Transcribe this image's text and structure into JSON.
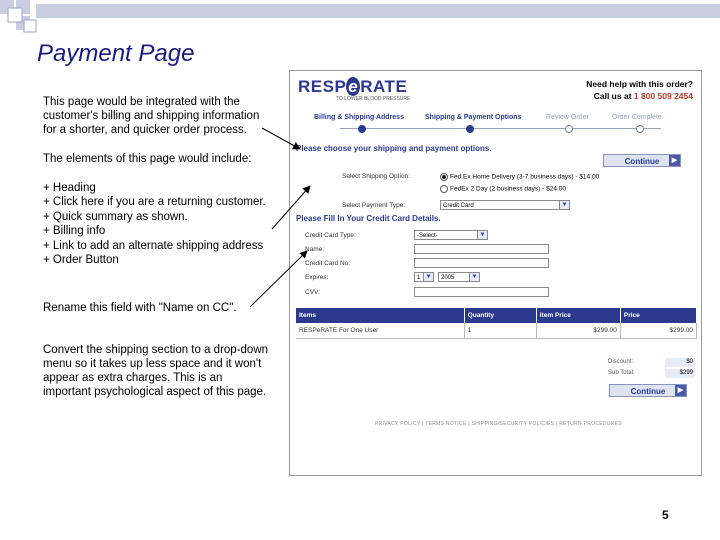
{
  "slide": {
    "title": "Payment Page",
    "intro": [
      "This page would be integrated with the",
      "customer's billing and shipping information",
      "for a shorter, and quicker order process."
    ],
    "elements_heading": "The elements of this page would include:",
    "bullets": [
      "+ Heading",
      "+ Click here if you are a returning customer.",
      "+ Quick summary as shown.",
      "+ Billing info",
      "+ Link to add an alternate shipping address",
      "+ Order Button"
    ],
    "rename_note": "Rename this field with \"Name on CC\".",
    "convert_note": [
      "Convert the shipping section to a drop-down",
      "menu so it takes up less space and it won't",
      "appear as extra charges.  This is an",
      "important psychological aspect of this page."
    ],
    "page_number": "5"
  },
  "shot": {
    "logo": {
      "pre": "RESP",
      "e": "e",
      "post": "RATE",
      "sub": "TO LOWER BLOOD PRESSURE"
    },
    "help_title": "Need help with this order?",
    "help_call_prefix": "Call us at",
    "help_phone": "1 800 509 2454",
    "steps": [
      "Billing & Shipping Address",
      "Shipping & Payment Options",
      "Review Order",
      "Order Complete"
    ],
    "choose_heading": "Please choose your shipping and payment options.",
    "continue_label": "Continue",
    "shipping_label": "Select Shipping Option:",
    "shipping_options": [
      "Fed.Ex Home Delivery (3-7 business days) - $14.00",
      "FedEx 2 Day (2 business days) - $24.00"
    ],
    "payment_type_label": "Select Payment Type:",
    "payment_type_value": "Credit Card",
    "cc_heading": "Please Fill In Your Credit Card Details.",
    "cc_fields": {
      "type_label": "Credit Card Type:",
      "type_value": "-Select-",
      "name_label": "Name:",
      "number_label": "Credit Card No:",
      "expiry_label": "Expires:",
      "expiry_month": "1",
      "expiry_year": "2005",
      "cvv_label": "CVV:"
    },
    "table": {
      "headers": [
        "Items",
        "Quantity",
        "Item Price",
        "Price"
      ],
      "rows": [
        [
          "RESPeRATE For One User",
          "1",
          "$299.00",
          "$299.00"
        ]
      ]
    },
    "discount_label": "Discount:",
    "discount_value": "$0",
    "subtotal_label": "Sub Total:",
    "subtotal_value": "$299",
    "footer_links": "PRIVACY POLICY  |  TERMS NOTICE  |  SHIPPING/SECURITY POLICIES  |  RETURN PROCEDURES"
  },
  "colors": {
    "title": "#1a1a80",
    "brand": "#2b3a8f",
    "phone": "#c0392b"
  }
}
